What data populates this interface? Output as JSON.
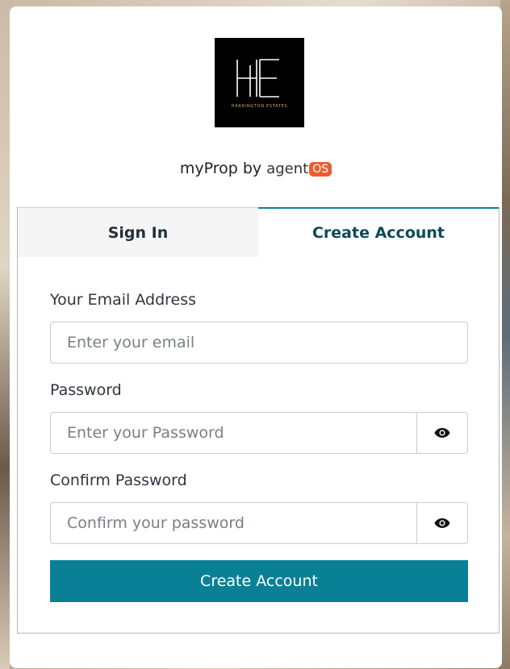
{
  "brand": {
    "logo_text": "HARRINGTON ESTATES",
    "tagline_prefix": "myProp by",
    "agent_word": "agent",
    "os_word": "OS"
  },
  "tabs": [
    {
      "label": "Sign In",
      "active": false
    },
    {
      "label": "Create Account",
      "active": true
    }
  ],
  "form": {
    "email": {
      "label": "Your Email Address",
      "placeholder": "Enter your email",
      "value": ""
    },
    "password": {
      "label": "Password",
      "placeholder": "Enter your Password",
      "value": ""
    },
    "confirm": {
      "label": "Confirm Password",
      "placeholder": "Confirm your password",
      "value": ""
    },
    "submit_label": "Create Account"
  },
  "colors": {
    "accent": "#0a8096",
    "active_tab_text": "#0b4a56",
    "os_badge": "#ef5b31"
  },
  "icons": {
    "password_toggle": "eye-icon",
    "confirm_toggle": "eye-icon"
  }
}
